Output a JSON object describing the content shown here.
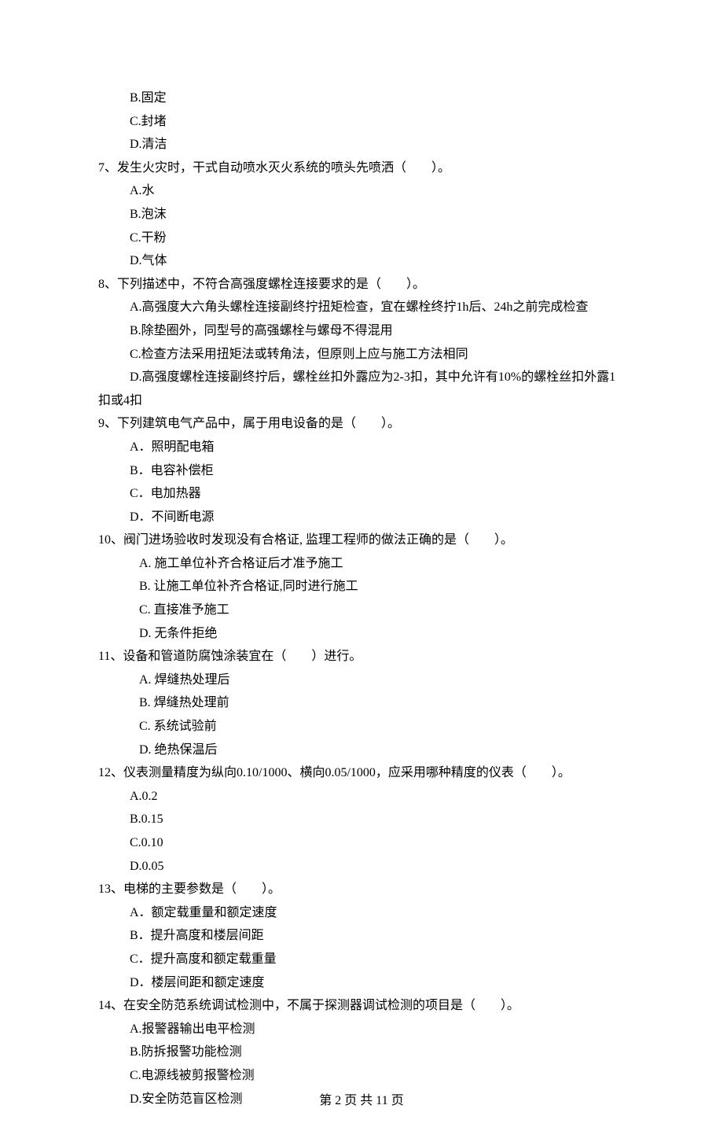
{
  "top_options": {
    "b": "B.固定",
    "c": "C.封堵",
    "d": "D.清洁"
  },
  "q7": {
    "stem": "7、发生火灾时，干式自动喷水灭火系统的喷头先喷洒（　　）。",
    "a": "A.水",
    "b": "B.泡沫",
    "c": "C.干粉",
    "d": "D.气体"
  },
  "q8": {
    "stem": "8、下列描述中，不符合高强度螺栓连接要求的是（　　）。",
    "a": "A.高强度大六角头螺栓连接副终拧扭矩检查，宜在螺栓终拧1h后、24h之前完成检查",
    "b": "B.除垫圈外，同型号的高强螺栓与螺母不得混用",
    "c": "C.检查方法采用扭矩法或转角法，但原则上应与施工方法相同",
    "d_line1": "D.高强度螺栓连接副终拧后，螺栓丝扣外露应为2-3扣，其中允许有10%的螺栓丝扣外露1",
    "d_line2": "扣或4扣"
  },
  "q9": {
    "stem": "9、下列建筑电气产品中，属于用电设备的是（　　）。",
    "a": "A．照明配电箱",
    "b": "B．电容补偿柜",
    "c": "C．电加热器",
    "d": "D．不间断电源"
  },
  "q10": {
    "stem": "10、阀门进场验收时发现没有合格证,  监理工程师的做法正确的是（　　）。",
    "a": "A.  施工单位补齐合格证后才准予施工",
    "b": "B.  让施工单位补齐合格证,同时进行施工",
    "c": "C.  直接准予施工",
    "d": "D.  无条件拒绝"
  },
  "q11": {
    "stem": "11、设备和管道防腐蚀涂装宜在（　　）进行。",
    "a": "A.  焊缝热处理后",
    "b": "B.  焊缝热处理前",
    "c": "C.  系统试验前",
    "d": "D.  绝热保温后"
  },
  "q12": {
    "stem": "12、仪表测量精度为纵向0.10/1000、横向0.05/1000，应采用哪种精度的仪表（　　）。",
    "a": "A.0.2",
    "b": "B.0.15",
    "c": "C.0.10",
    "d": "D.0.05"
  },
  "q13": {
    "stem": "13、电梯的主要参数是（　　）。",
    "a": "A．额定载重量和额定速度",
    "b": "B．提升高度和楼层间距",
    "c": "C．提升高度和额定载重量",
    "d": "D．楼层间距和额定速度"
  },
  "q14": {
    "stem": "14、在安全防范系统调试检测中，不属于探测器调试检测的项目是（　　）。",
    "a": "A.报警器输出电平检测",
    "b": "B.防拆报警功能检测",
    "c": "C.电源线被剪报警检测",
    "d": "D.安全防范盲区检测"
  },
  "footer": "第 2 页 共 11 页"
}
